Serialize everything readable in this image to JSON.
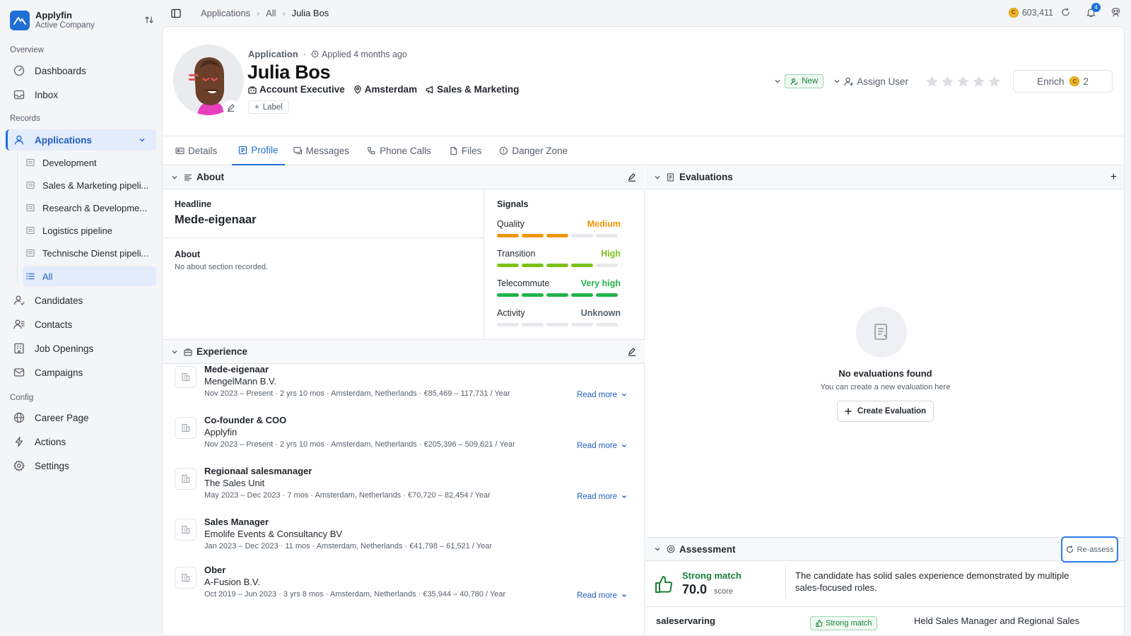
{
  "brand": {
    "name": "Applyfin",
    "company": "Active Company"
  },
  "sidebar": {
    "section_overview": "Overview",
    "section_records": "Records",
    "section_config": "Config",
    "overview": [
      {
        "label": "Dashboards",
        "icon": "dashboard-icon"
      },
      {
        "label": "Inbox",
        "icon": "inbox-icon"
      }
    ],
    "applications_label": "Applications",
    "pipelines": [
      {
        "label": "Development"
      },
      {
        "label": "Sales & Marketing pipeli..."
      },
      {
        "label": "Research & Developme..."
      },
      {
        "label": "Logistics pipeline"
      },
      {
        "label": "Technische Dienst pipeli..."
      },
      {
        "label": "All"
      }
    ],
    "records": [
      {
        "label": "Candidates",
        "icon": "candidates-icon"
      },
      {
        "label": "Contacts",
        "icon": "contacts-icon"
      },
      {
        "label": "Job Openings",
        "icon": "job-openings-icon"
      },
      {
        "label": "Campaigns",
        "icon": "campaigns-icon"
      }
    ],
    "config": [
      {
        "label": "Career Page",
        "icon": "globe-icon"
      },
      {
        "label": "Actions",
        "icon": "bolt-icon"
      },
      {
        "label": "Settings",
        "icon": "gear-icon"
      }
    ]
  },
  "breadcrumb": {
    "items": [
      "Applications",
      "All",
      "Julia Bos"
    ]
  },
  "topbar": {
    "credits": "603,411",
    "notifications": "4"
  },
  "header": {
    "kicker": "Application",
    "applied": "Applied 4 months ago",
    "name": "Julia Bos",
    "role": "Account Executive",
    "location": "Amsterdam",
    "department": "Sales & Marketing",
    "label_button": "Label",
    "status": "New",
    "assign_user": "Assign User",
    "rating": 0,
    "rating_max": 5,
    "enrich_label": "Enrich",
    "enrich_cost": "2"
  },
  "tabs": [
    {
      "label": "Details"
    },
    {
      "label": "Profile"
    },
    {
      "label": "Messages"
    },
    {
      "label": "Phone Calls"
    },
    {
      "label": "Files"
    },
    {
      "label": "Danger Zone"
    }
  ],
  "about": {
    "title": "About",
    "headline_label": "Headline",
    "headline": "Mede-eigenaar",
    "about_label": "About",
    "about_text": "No about section recorded."
  },
  "signals": {
    "title": "Signals",
    "items": [
      {
        "label": "Quality",
        "value": "Medium",
        "level": 3,
        "color": "#f0960a"
      },
      {
        "label": "Transition",
        "value": "High",
        "level": 4,
        "color": "#7cc11a"
      },
      {
        "label": "Telecommute",
        "value": "Very high",
        "level": 5,
        "color": "#22b34a"
      },
      {
        "label": "Activity",
        "value": "Unknown",
        "level": 0,
        "color": "#57606a"
      }
    ]
  },
  "experience": {
    "title": "Experience",
    "read_more": "Read more",
    "items": [
      {
        "title": "Mede-eigenaar",
        "company": "MengelMann B.V.",
        "meta": "Nov 2023 – Present · 2 yrs 10 mos · Amsterdam, Netherlands · €85,469 – 117,731 / Year",
        "read_more": true
      },
      {
        "title": "Co-founder & COO",
        "company": "Applyfin",
        "meta": "Nov 2023 – Present · 2 yrs 10 mos · Amsterdam, Netherlands · €205,396 – 509,621 / Year",
        "read_more": true
      },
      {
        "title": "Regionaal salesmanager",
        "company": "The Sales Unit",
        "meta": "May 2023 – Dec 2023 · 7 mos · Amsterdam, Netherlands · €70,720 – 82,454 / Year",
        "read_more": true
      },
      {
        "title": "Sales Manager",
        "company": "Emolife Events & Consultancy BV",
        "meta": "Jan 2023 – Dec 2023 · 11 mos · Amsterdam, Netherlands · €41,798 – 61,521 / Year",
        "read_more": false
      },
      {
        "title": "Ober",
        "company": "A-Fusion B.V.",
        "meta": "Oct 2019 – Jun 2023 · 3 yrs 8 mos · Amsterdam, Netherlands · €35,944 – 40,780 / Year",
        "read_more": true
      }
    ]
  },
  "evaluations": {
    "title": "Evaluations",
    "empty_title": "No evaluations found",
    "empty_sub": "You can create a new evaluation here",
    "create_button": "Create Evaluation"
  },
  "assessment": {
    "title": "Assessment",
    "reassess": "Re-assess",
    "match": "Strong match",
    "score": "70.0",
    "score_unit": "score",
    "summary": "The candidate has solid sales experience demonstrated by multiple sales-focused roles.",
    "criterion": {
      "name": "saleservaring",
      "match": "Strong match",
      "text": "Held Sales Manager and Regional Sales"
    }
  }
}
